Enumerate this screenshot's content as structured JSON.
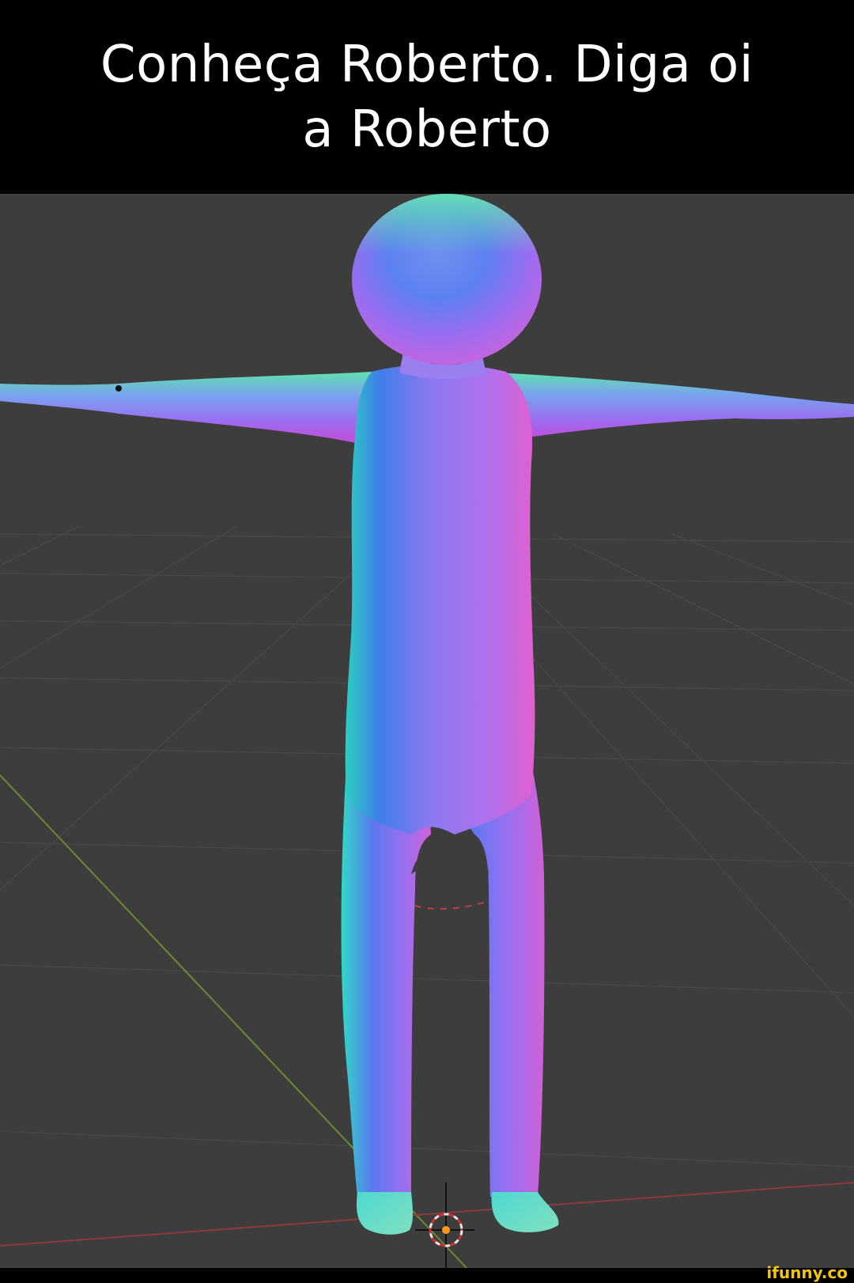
{
  "caption": {
    "text": "Conheça Roberto. Diga oi a Roberto"
  },
  "watermark": {
    "text": "ifunny.co"
  },
  "colors": {
    "background": "#3d3d3d",
    "caption_bg": "#000000",
    "caption_text": "#ffffff",
    "watermark": "#f2c40f",
    "x_axis": "#8c3a3a",
    "y_axis": "#6a8a2e"
  }
}
